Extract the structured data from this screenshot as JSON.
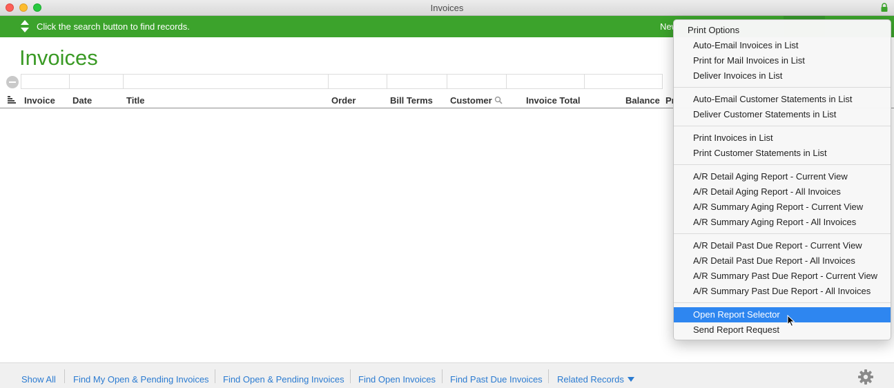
{
  "window": {
    "title": "Invoices"
  },
  "toolbar": {
    "hint": "Click the search button to find records.",
    "new_label": "New"
  },
  "page": {
    "title": "Invoices"
  },
  "columns": [
    "Invoice",
    "Date",
    "Title",
    "Order",
    "Bill Terms",
    "Customer",
    "Invoice Total",
    "Balance",
    "Pr"
  ],
  "footer": {
    "links": [
      "Show All",
      "Find My Open & Pending Invoices",
      "Find Open & Pending Invoices",
      "Find Open Invoices",
      "Find Past Due Invoices",
      "Related Records"
    ]
  },
  "menu": {
    "heading": "Print Options",
    "groups": [
      [
        "Auto-Email Invoices in List",
        "Print for Mail Invoices in List",
        "Deliver Invoices in List"
      ],
      [
        "Auto-Email Customer Statements in List",
        "Deliver Customer Statements in List"
      ],
      [
        "Print Invoices in List",
        "Print Customer Statements in List"
      ],
      [
        "A/R Detail Aging Report - Current View",
        "A/R Detail Aging Report - All Invoices",
        "A/R Summary Aging Report - Current View",
        "A/R Summary Aging Report - All Invoices"
      ],
      [
        "A/R Detail Past Due Report - Current View",
        "A/R Detail Past Due Report - All Invoices",
        "A/R Summary Past Due Report - Current View",
        "A/R Summary Past Due Report - All Invoices"
      ],
      [
        "Open Report Selector",
        "Send Report Request"
      ]
    ],
    "selected": "Open Report Selector"
  },
  "colors": {
    "accent_green": "#3ca32c",
    "title_green": "#3a9a25",
    "link_blue": "#2b7bd1",
    "selection_blue": "#2e86f0"
  },
  "icons": [
    "close-button",
    "minimize-button",
    "zoom-button",
    "lock-icon",
    "sort-arrows-icon",
    "remove-filter-icon",
    "column-options-icon",
    "search-icon",
    "caret-down-icon",
    "gear-icon",
    "pointer-cursor"
  ]
}
